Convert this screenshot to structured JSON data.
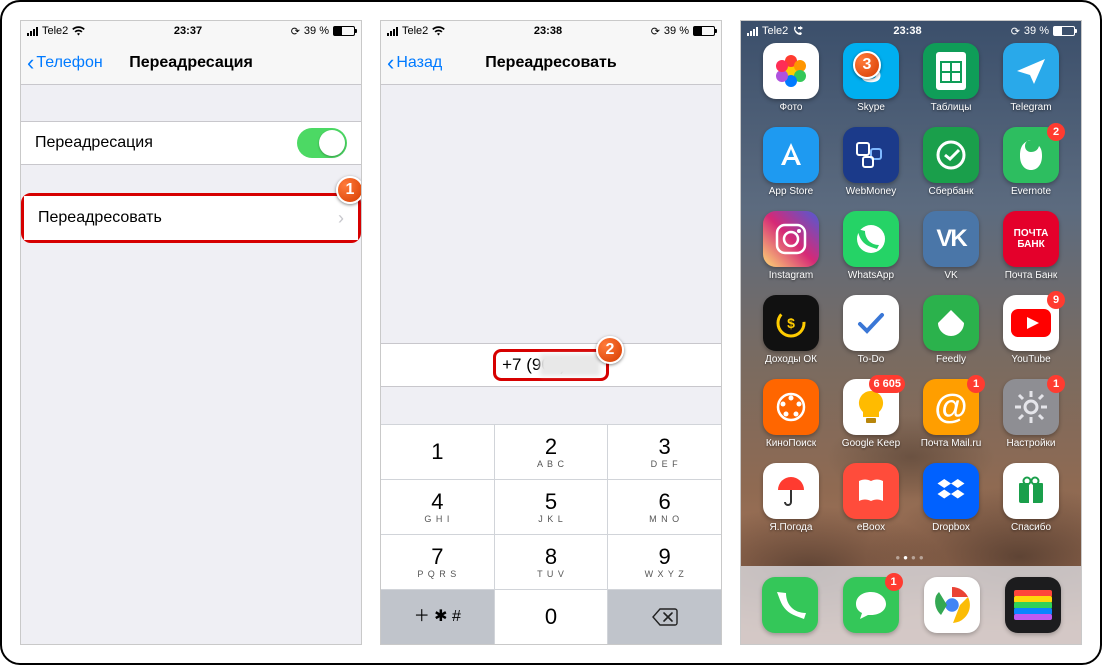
{
  "status": {
    "carrier": "Tele2",
    "wifi": true,
    "battery_pct": "39 %",
    "s1_time": "23:37",
    "s2_time": "23:38",
    "s3_time": "23:38"
  },
  "callouts": {
    "c1": "1",
    "c2": "2",
    "c3": "3"
  },
  "s1": {
    "back_label": "Телефон",
    "title": "Переадресация",
    "toggle_label": "Переадресация",
    "toggle_on": true,
    "forward_label": "Переадресовать"
  },
  "s2": {
    "back_label": "Назад",
    "title": "Переадресовать",
    "phone_value": "+7 (904)",
    "keys": [
      {
        "n": "1",
        "s": ""
      },
      {
        "n": "2",
        "s": "A B C"
      },
      {
        "n": "3",
        "s": "D E F"
      },
      {
        "n": "4",
        "s": "G H I"
      },
      {
        "n": "5",
        "s": "J K L"
      },
      {
        "n": "6",
        "s": "M N O"
      },
      {
        "n": "7",
        "s": "P Q R S"
      },
      {
        "n": "8",
        "s": "T U V"
      },
      {
        "n": "9",
        "s": "W X Y Z"
      }
    ],
    "symbols_key": "＋ ✱ #",
    "zero_key": "0"
  },
  "s3": {
    "apps": [
      {
        "id": "photos",
        "label": "Фото",
        "icon": "flower",
        "bg": "#ffffff",
        "fg": "#ff3b30"
      },
      {
        "id": "skype",
        "label": "Skype",
        "icon": "S",
        "bg": "#00aff0"
      },
      {
        "id": "sheets",
        "label": "Таблицы",
        "icon": "sheets",
        "bg": "#0f9d58"
      },
      {
        "id": "telegram",
        "label": "Telegram",
        "icon": "plane",
        "bg": "#29a9ea"
      },
      {
        "id": "appstore",
        "label": "App Store",
        "icon": "A",
        "bg": "#1e9af1"
      },
      {
        "id": "webmoney",
        "label": "WebMoney",
        "icon": "wm",
        "bg": "#1b3a8a"
      },
      {
        "id": "sber",
        "label": "Сбербанк",
        "icon": "sber",
        "bg": "#1a9f4b"
      },
      {
        "id": "evernote",
        "label": "Evernote",
        "icon": "ever",
        "bg": "#2dbe60",
        "badge": "2"
      },
      {
        "id": "instagram",
        "label": "Instagram",
        "icon": "ig",
        "bg": "linear-gradient(45deg,#feda75,#d62976,#4f5bd5)"
      },
      {
        "id": "whatsapp",
        "label": "WhatsApp",
        "icon": "wa",
        "bg": "#25d366"
      },
      {
        "id": "vk",
        "label": "VK",
        "icon": "vk",
        "bg": "#4a76a8"
      },
      {
        "id": "pochtabank",
        "label": "Почта Банк",
        "icon": "ПОЧТА\nБАНК",
        "bg": "#e4002b"
      },
      {
        "id": "dohody",
        "label": "Доходы ОК",
        "icon": "dok",
        "bg": "#111111"
      },
      {
        "id": "todo",
        "label": "To-Do",
        "icon": "check",
        "bg": "#ffffff",
        "fg": "#3a77d6"
      },
      {
        "id": "feedly",
        "label": "Feedly",
        "icon": "feedly",
        "bg": "#2bb24c"
      },
      {
        "id": "youtube",
        "label": "YouTube",
        "icon": "yt",
        "bg": "#ffffff",
        "fg": "#ff0000",
        "badge": "9"
      },
      {
        "id": "kinopoisk",
        "label": "КиноПоиск",
        "icon": "kp",
        "bg": "#ff6600"
      },
      {
        "id": "keep",
        "label": "Google Keep",
        "icon": "keep",
        "bg": "#ffffff",
        "fg": "#ffbb00",
        "badge": "6 605"
      },
      {
        "id": "mailru",
        "label": "Почта Mail.ru",
        "icon": "@",
        "bg": "#ff9e00",
        "badge": "1"
      },
      {
        "id": "settings",
        "label": "Настройки",
        "icon": "gear",
        "bg": "#8e8e93",
        "badge": "1"
      },
      {
        "id": "yaweather",
        "label": "Я.Погода",
        "icon": "umb",
        "bg": "#ffffff",
        "fg": "#ff3b30"
      },
      {
        "id": "eboox",
        "label": "eBoox",
        "icon": "book",
        "bg": "#ff4c3b"
      },
      {
        "id": "dropbox",
        "label": "Dropbox",
        "icon": "db",
        "bg": "#0061ff"
      },
      {
        "id": "spasibo",
        "label": "Спасибо",
        "icon": "gift",
        "bg": "#ffffff",
        "fg": "#1a9f4b"
      }
    ],
    "dock": [
      {
        "id": "phone",
        "icon": "phone",
        "bg": "#34c759"
      },
      {
        "id": "messages",
        "icon": "msg",
        "bg": "#34c759",
        "badge": "1"
      },
      {
        "id": "chrome",
        "icon": "chrome",
        "bg": "#ffffff"
      },
      {
        "id": "wallet",
        "icon": "wallet",
        "bg": "#1c1c1e"
      }
    ]
  }
}
